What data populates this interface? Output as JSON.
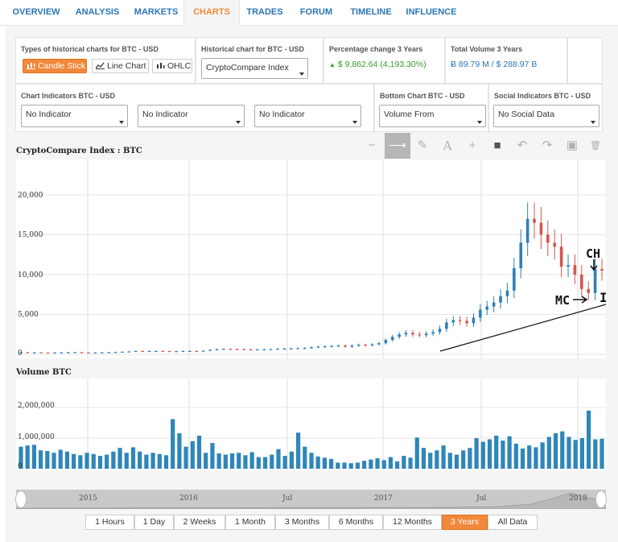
{
  "nav": {
    "tabs": [
      {
        "label": "OVERVIEW"
      },
      {
        "label": "ANALYSIS"
      },
      {
        "label": "MARKETS"
      },
      {
        "label": "CHARTS",
        "active": true
      },
      {
        "label": "TRADES"
      },
      {
        "label": "FORUM"
      },
      {
        "label": "TIMELINE"
      },
      {
        "label": "INFLUENCE"
      }
    ]
  },
  "config": {
    "types_label": "Types of historical charts for BTC - USD",
    "types": [
      {
        "label": "Candle Stick",
        "icon": "candlestick-icon",
        "active": true
      },
      {
        "label": "Line Chart",
        "icon": "line-chart-icon"
      },
      {
        "label": "OHLC",
        "icon": "ohlc-icon"
      }
    ],
    "historical_label": "Historical chart for BTC - USD",
    "historical_value": "CryptoCompare Index",
    "pct_label": "Percentage change 3 Years",
    "pct_value": "$ 9,862.64 (4,193.30%)",
    "pct_color": "#3a9a2d",
    "volume_label": "Total Volume 3 Years",
    "volume_value": "Ƀ 89.79 M / $ 288.97 B",
    "volume_color": "#2b76b3"
  },
  "indicators": {
    "chart_label": "Chart Indicators BTC - USD",
    "chart_values": [
      "No Indicator",
      "No Indicator",
      "No Indicator"
    ],
    "bottom_label": "Bottom Chart BTC - USD",
    "bottom_value": "Volume From",
    "social_label": "Social Indicators BTC - USD",
    "social_value": "No Social Data"
  },
  "toolbar": {
    "tools": [
      "minus-icon",
      "arrow-right-icon",
      "pencil-icon",
      "text-icon",
      "plus-icon",
      "square-icon",
      "undo-icon",
      "redo-icon",
      "save-icon",
      "trash-icon"
    ],
    "glyphs": [
      "−",
      "⟶",
      "✎",
      "A",
      "+",
      "■",
      "↶",
      "↷",
      "▣",
      "🗑"
    ]
  },
  "price_chart": {
    "title": "CryptoCompare Index : BTC",
    "y_ticks": [
      "20,000",
      "15,000",
      "10,000",
      "5,000",
      "0"
    ]
  },
  "volume_chart": {
    "title": "Volume BTC",
    "y_ticks": [
      "2,000,000",
      "1,000,000",
      "0"
    ]
  },
  "annotations": {
    "ch": "CH",
    "mc": "MC",
    "ib": "IB"
  },
  "navigator": {
    "labels": [
      "2015",
      "2016",
      "Jul",
      "2017",
      "Jul",
      "2018"
    ]
  },
  "ranges": [
    {
      "label": "1 Hours"
    },
    {
      "label": "1 Day"
    },
    {
      "label": "2 Weeks"
    },
    {
      "label": "1 Month"
    },
    {
      "label": "3 Months"
    },
    {
      "label": "6 Months"
    },
    {
      "label": "12 Months"
    },
    {
      "label": "3 Years",
      "active": true
    },
    {
      "label": "All Data"
    }
  ],
  "colors": {
    "accent": "#f1883a",
    "link": "#2b76b3",
    "up_candle": "#2f7fb7",
    "down_candle": "#d9534f",
    "volume_bar": "#2f86b8"
  },
  "chart_data": [
    {
      "type": "candlestick",
      "title": "CryptoCompare Index : BTC",
      "ylim": [
        0,
        20000
      ],
      "y_ticks": [
        0,
        5000,
        10000,
        15000,
        20000
      ],
      "x_labels": [
        "2015",
        "2016",
        "Jul",
        "2017",
        "Jul",
        "2018"
      ],
      "approx_weekly_close": [
        260,
        240,
        250,
        230,
        220,
        240,
        250,
        260,
        280,
        240,
        230,
        240,
        250,
        270,
        290,
        330,
        360,
        420,
        380,
        430,
        430,
        410,
        380,
        400,
        420,
        430,
        420,
        450,
        560,
        640,
        680,
        660,
        650,
        620,
        600,
        610,
        620,
        650,
        700,
        720,
        740,
        780,
        800,
        900,
        960,
        1000,
        1050,
        1100,
        950,
        1100,
        1200,
        1150,
        1250,
        1400,
        1800,
        2200,
        2500,
        2700,
        2500,
        2400,
        2600,
        2800,
        3200,
        4000,
        4300,
        4200,
        3900,
        4600,
        5600,
        6000,
        6500,
        7300,
        8000,
        10800,
        14000,
        17000,
        16500,
        15000,
        14000,
        13500,
        11000,
        11200,
        10000,
        8200,
        7700,
        10700,
        10500
      ]
    },
    {
      "type": "bar",
      "title": "Volume BTC",
      "ylim": [
        0,
        2500000
      ],
      "y_ticks": [
        0,
        1000000,
        2000000
      ],
      "approx_weekly_volume": [
        720000,
        760000,
        780000,
        600000,
        580000,
        520000,
        620000,
        560000,
        480000,
        440000,
        520000,
        480000,
        420000,
        460000,
        560000,
        680000,
        520000,
        700000,
        560000,
        460000,
        520000,
        480000,
        440000,
        1620000,
        1160000,
        720000,
        900000,
        1080000,
        520000,
        840000,
        500000,
        460000,
        500000,
        520000,
        440000,
        540000,
        380000,
        380000,
        460000,
        640000,
        420000,
        560000,
        1180000,
        720000,
        520000,
        400000,
        360000,
        320000,
        200000,
        200000,
        180000,
        200000,
        260000,
        300000,
        340000,
        280000,
        380000,
        240000,
        420000,
        360000,
        1020000,
        680000,
        520000,
        600000,
        760000,
        520000,
        460000,
        600000,
        680000,
        1000000,
        880000,
        960000,
        1080000,
        920000,
        1060000,
        820000,
        660000,
        760000,
        700000,
        860000,
        1040000,
        1160000,
        1220000,
        1040000,
        940000,
        1000000,
        1900000,
        960000,
        980000
      ]
    }
  ]
}
